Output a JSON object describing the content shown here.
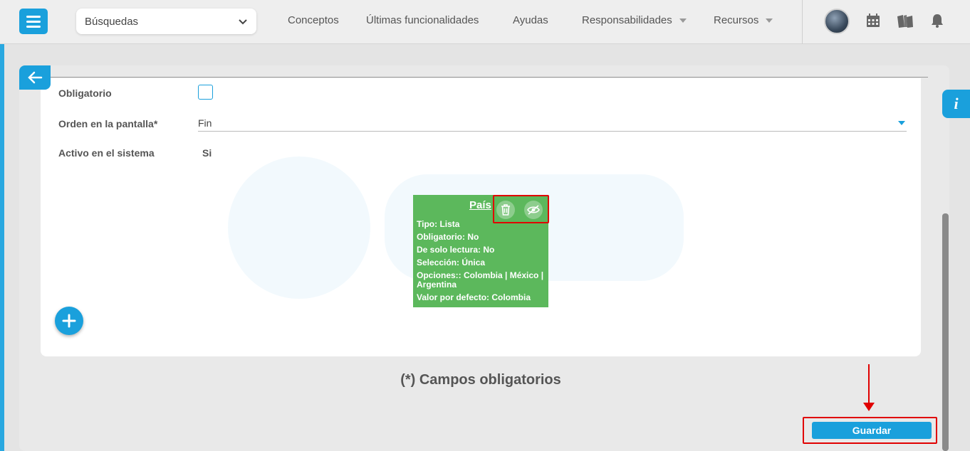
{
  "topbar": {
    "search_select": "Búsquedas",
    "nav": [
      {
        "label": "Conceptos"
      },
      {
        "label": "Últimas funcionalidades"
      },
      {
        "label": "Ayudas"
      },
      {
        "label": "Responsabilidades"
      },
      {
        "label": "Recursos"
      }
    ]
  },
  "form": {
    "obligatorio_label": "Obligatorio",
    "orden_label": "Orden en la pantalla*",
    "orden_value": "Fin",
    "activo_label": "Activo en el sistema",
    "activo_value": "Si"
  },
  "field_card": {
    "title": "País",
    "lines": [
      "Tipo: Lista",
      "Obligatorio: No",
      "De solo lectura: No",
      "Selección: Única",
      "Opciones:: Colombia | México | Argentina",
      "Valor por defecto: Colombia"
    ],
    "color": "#5cb85c"
  },
  "footer": {
    "required_note": "(*) Campos obligatorios",
    "save_label": "Guardar"
  },
  "info_tab_label": "i",
  "colors": {
    "accent": "#1aa0dc",
    "highlight": "#e00000"
  }
}
